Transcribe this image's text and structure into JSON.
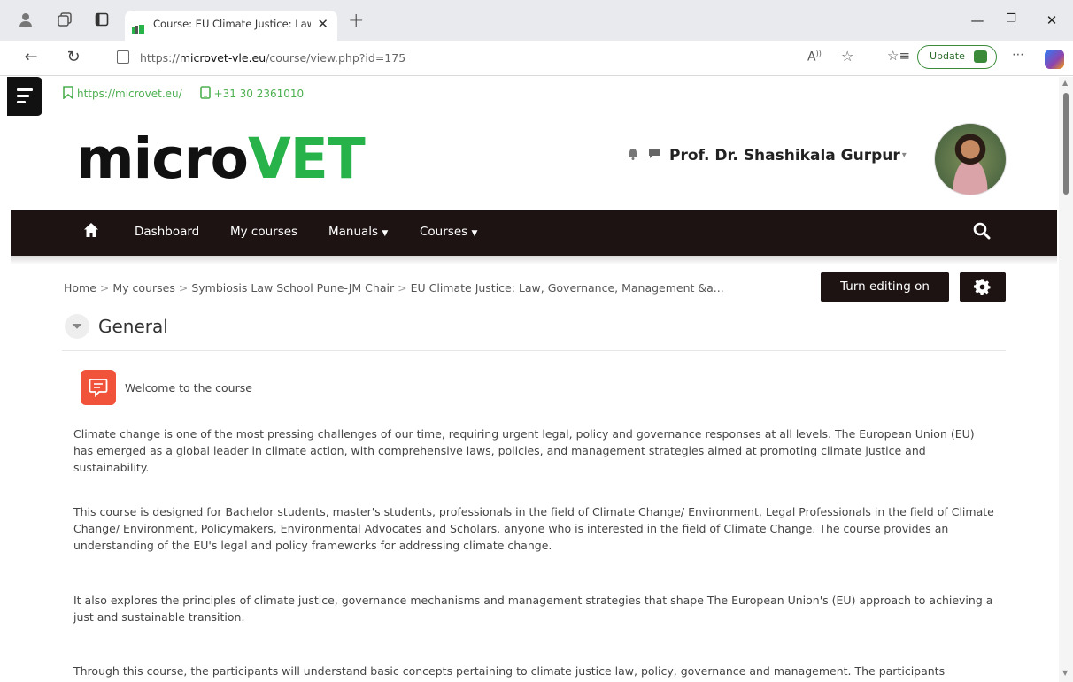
{
  "browser": {
    "tab_title": "Course: EU Climate Justice: Law, G",
    "url_prefix": "https://",
    "url_domain": "microvet-vle.eu",
    "url_path": "/course/view.php?id=175",
    "update_label": "Update"
  },
  "topinfo": {
    "website": "https://microvet.eu/",
    "phone": "+31 30 2361010"
  },
  "logo": {
    "part1": "micro",
    "part2": "VET"
  },
  "user": {
    "name": "Prof. Dr. Shashikala Gurpur"
  },
  "nav": {
    "items": [
      "Dashboard",
      "My courses",
      "Manuals",
      "Courses"
    ]
  },
  "breadcrumb": [
    "Home",
    "My courses",
    "Symbiosis Law School Pune-JM Chair",
    "EU Climate Justice: Law, Governance, Management &a..."
  ],
  "actions": {
    "edit_label": "Turn editing on"
  },
  "section": {
    "title": "General",
    "activity": "Welcome to the course",
    "paragraphs": [
      "Climate change is one of the most pressing challenges of our time, requiring urgent legal, policy and governance responses at all levels. The European Union (EU) has emerged as a global leader in climate action, with comprehensive laws, policies, and management strategies aimed at promoting climate justice and sustainability.",
      "This course is designed for Bachelor students, master's students, professionals in the field of Climate Change/ Environment, Legal Professionals in the field of Climate Change/ Environment, Policymakers, Environmental Advocates and Scholars, anyone who is interested in the field of Climate Change. The course provides an understanding of the EU's legal and policy frameworks for addressing climate change.",
      "It also explores the principles of climate justice, governance mechanisms and management strategies that shape The European Union's (EU) approach to achieving a just and sustainable transition.",
      "Through this course, the participants will understand basic concepts pertaining to climate justice law, policy, governance and management. The participants"
    ]
  },
  "colors": {
    "brand_green": "#27b24a",
    "nav_dark": "#1d1313",
    "forum_orange": "#f0533a"
  },
  "icons": [
    "profile-icon",
    "collections-icon",
    "tab-actions-icon",
    "back-icon",
    "refresh-icon",
    "read-aloud-icon",
    "favorite-icon",
    "favorites-bar-icon",
    "more-icon",
    "copilot-icon",
    "drawer-icon",
    "bookmark-icon",
    "phone-icon",
    "notification-bell-icon",
    "messages-icon",
    "home-icon",
    "search-icon",
    "gear-icon",
    "chevron-down-icon",
    "forum-icon"
  ]
}
